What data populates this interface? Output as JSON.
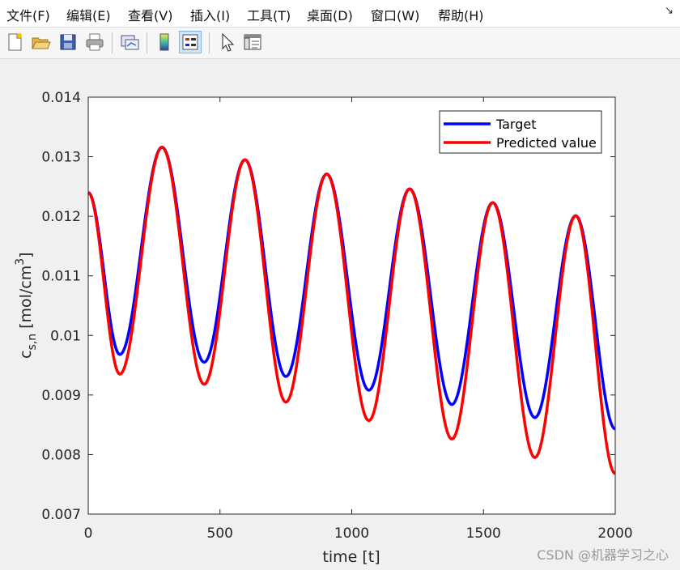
{
  "menubar": {
    "items": [
      "文件(F)",
      "编辑(E)",
      "查看(V)",
      "插入(I)",
      "工具(T)",
      "桌面(D)",
      "窗口(W)",
      "帮助(H)"
    ]
  },
  "toolbar": {
    "buttons": [
      "new-figure-icon",
      "open-folder-icon",
      "save-icon",
      "print-icon",
      "link-plot-icon",
      "colorbar-icon",
      "legend-icon",
      "pointer-icon",
      "property-editor-icon"
    ]
  },
  "watermark": "CSDN @机器学习之心",
  "chart_data": {
    "type": "line",
    "xlabel": "time [t]",
    "ylabel": "c",
    "ylabel_subscript": "s,n",
    "ylabel_unit": "[mol/cm",
    "ylabel_superscript": "3",
    "ylabel_close": "]",
    "xlim": [
      0,
      2000
    ],
    "ylim": [
      0.007,
      0.014
    ],
    "xticks": [
      0,
      500,
      1000,
      1500,
      2000
    ],
    "xtick_labels": [
      "0",
      "500",
      "1000",
      "1500",
      "2000"
    ],
    "yticks": [
      0.007,
      0.008,
      0.009,
      0.01,
      0.011,
      0.012,
      0.013,
      0.014
    ],
    "ytick_labels": [
      "0.007",
      "0.008",
      "0.009",
      "0.01",
      "0.011",
      "0.012",
      "0.013",
      "0.014"
    ],
    "grid": false,
    "legend_position": "top-right",
    "series": [
      {
        "name": "Target",
        "color": "#0000ff",
        "x": [
          0,
          120,
          280,
          440,
          595,
          750,
          905,
          1065,
          1220,
          1380,
          1535,
          1695,
          1850,
          2000
        ],
        "y": [
          0.0124,
          0.00968,
          0.01316,
          0.00955,
          0.01295,
          0.00931,
          0.01271,
          0.00908,
          0.01246,
          0.00884,
          0.01223,
          0.00862,
          0.01201,
          0.00843
        ]
      },
      {
        "name": "Predicted value",
        "color": "#ff0000",
        "x": [
          0,
          120,
          280,
          440,
          595,
          750,
          905,
          1065,
          1220,
          1380,
          1535,
          1695,
          1850,
          2000
        ],
        "y": [
          0.0124,
          0.00935,
          0.01316,
          0.00918,
          0.01295,
          0.00888,
          0.01271,
          0.00857,
          0.01246,
          0.00826,
          0.01223,
          0.00795,
          0.01201,
          0.00768
        ]
      }
    ]
  }
}
